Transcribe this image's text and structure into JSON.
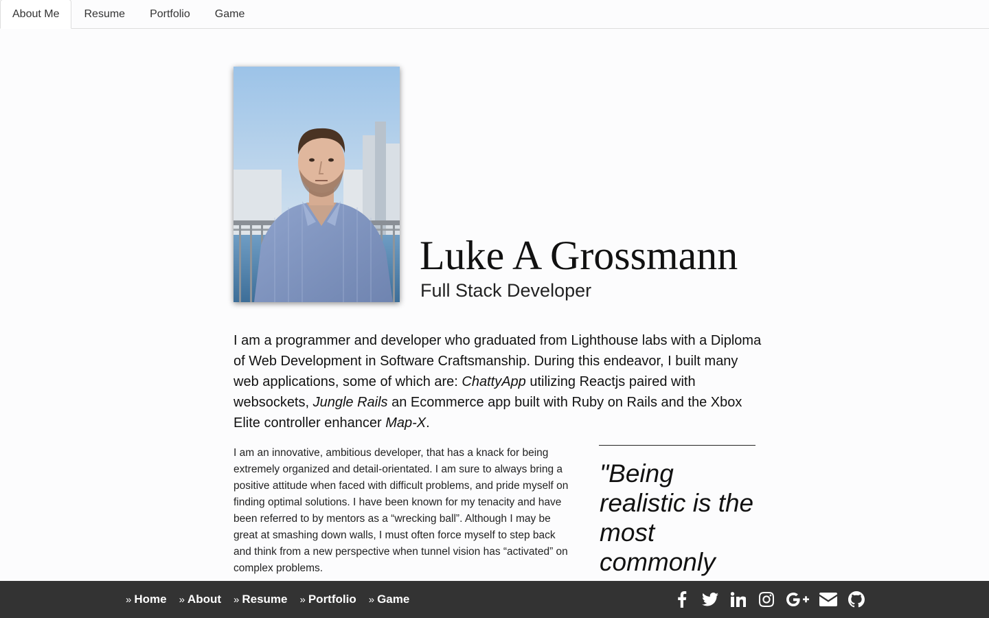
{
  "tabs": [
    {
      "label": "About Me",
      "active": true
    },
    {
      "label": "Resume",
      "active": false
    },
    {
      "label": "Portfolio",
      "active": false
    },
    {
      "label": "Game",
      "active": false
    }
  ],
  "profile": {
    "name": "Luke A Grossmann",
    "role": "Full Stack Developer"
  },
  "intro": {
    "part1": "I am a programmer and developer who graduated from Lighthouse labs with a Diploma of Web Development in Software Craftsmanship. During this endeavor, I built many web applications, some of which are: ",
    "app1": "ChattyApp",
    "part2": " utilizing Reactjs paired with websockets, ",
    "app2": "Jungle Rails",
    "part3": " an Ecommerce app built with Ruby on Rails and the Xbox Elite controller enhancer ",
    "app3": "Map-X",
    "part4": "."
  },
  "bio": "I am an innovative, ambitious developer, that has a knack for being extremely organized and detail-orientated. I am sure to always bring a positive attitude when faced with difficult problems, and pride myself on finding optimal solutions. I have been known for my tenacity and have been referred to by mentors as a “wrecking ball”. Although I may be great at smashing down walls, I must often force myself to step back and think from a new perspective when tunnel vision has “activated” on complex problems.",
  "quote": "\"Being realistic is the most commonly",
  "footer": {
    "links": [
      "Home",
      "About",
      "Resume",
      "Portfolio",
      "Game"
    ],
    "chevron": "»",
    "social_icons": [
      "facebook-icon",
      "twitter-icon",
      "linkedin-icon",
      "instagram-icon",
      "google-plus-icon",
      "envelope-icon",
      "github-icon"
    ]
  },
  "colors": {
    "footer_bg": "#333333",
    "page_bg": "#fcfcfd",
    "text": "#111111"
  }
}
